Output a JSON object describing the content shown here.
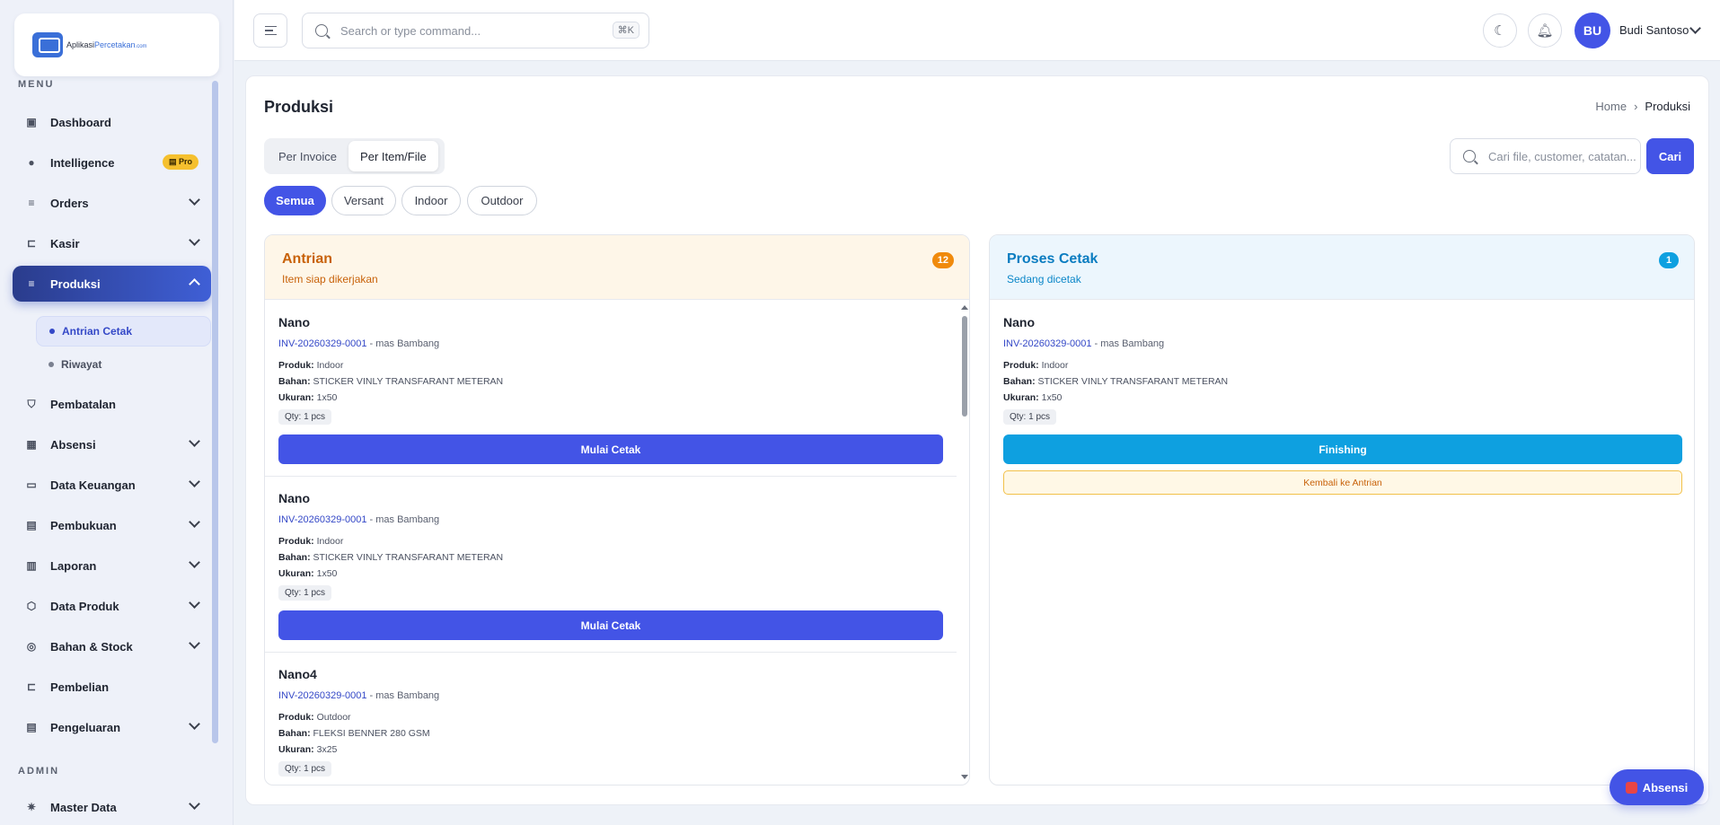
{
  "brand": {
    "logo_prefix": "Aplikasi",
    "logo_highlight": "Percetakan",
    "logo_suffix": ".com"
  },
  "sidebar": {
    "menu_heading": "MENU",
    "admin_heading": "ADMIN",
    "items": [
      {
        "label": "Dashboard"
      },
      {
        "label": "Intelligence",
        "badge": "Pro"
      },
      {
        "label": "Orders"
      },
      {
        "label": "Kasir"
      },
      {
        "label": "Produksi"
      },
      {
        "label": "Pembatalan"
      },
      {
        "label": "Absensi"
      },
      {
        "label": "Data Keuangan"
      },
      {
        "label": "Pembukuan"
      },
      {
        "label": "Laporan"
      },
      {
        "label": "Data Produk"
      },
      {
        "label": "Bahan & Stock"
      },
      {
        "label": "Pembelian"
      },
      {
        "label": "Pengeluaran"
      },
      {
        "label": "Master Data"
      }
    ],
    "sub_items": [
      {
        "label": "Antrian Cetak"
      },
      {
        "label": "Riwayat"
      }
    ]
  },
  "topbar": {
    "search_placeholder": "Search or type command...",
    "shortcut": "⌘K",
    "user_initials": "BU",
    "user_name": "Budi Santoso"
  },
  "page": {
    "title": "Produksi",
    "breadcrumb_home": "Home",
    "breadcrumb_current": "Produksi",
    "tabs": [
      {
        "label": "Per Invoice"
      },
      {
        "label": "Per Item/File"
      }
    ],
    "search_placeholder": "Cari file, customer, catatan...",
    "search_button": "Cari",
    "filters": [
      {
        "label": "Semua"
      },
      {
        "label": "Versant"
      },
      {
        "label": "Indoor"
      },
      {
        "label": "Outdoor"
      }
    ]
  },
  "columns": {
    "antrian": {
      "title": "Antrian",
      "subtitle": "Item siap dikerjakan",
      "count": "12",
      "action_label": "Mulai Cetak",
      "cards": [
        {
          "name": "Nano",
          "invoice": "INV-20260329-0001",
          "customer": " - mas Bambang",
          "produk_label": "Produk:",
          "produk": " Indoor",
          "bahan_label": "Bahan:",
          "bahan": " STICKER VINLY TRANSFARANT METERAN",
          "ukuran_label": "Ukuran:",
          "ukuran": " 1x50",
          "qty": "Qty: 1 pcs"
        },
        {
          "name": "Nano",
          "invoice": "INV-20260329-0001",
          "customer": " - mas Bambang",
          "produk_label": "Produk:",
          "produk": " Indoor",
          "bahan_label": "Bahan:",
          "bahan": " STICKER VINLY TRANSFARANT METERAN",
          "ukuran_label": "Ukuran:",
          "ukuran": " 1x50",
          "qty": "Qty: 1 pcs"
        },
        {
          "name": "Nano4",
          "invoice": "INV-20260329-0001",
          "customer": " - mas Bambang",
          "produk_label": "Produk:",
          "produk": " Outdoor",
          "bahan_label": "Bahan:",
          "bahan": " FLEKSI BENNER 280 GSM",
          "ukuran_label": "Ukuran:",
          "ukuran": " 3x25",
          "qty": "Qty: 1 pcs"
        }
      ]
    },
    "proses": {
      "title": "Proses Cetak",
      "subtitle": "Sedang dicetak",
      "count": "1",
      "finish_label": "Finishing",
      "back_label": "Kembali ke Antrian",
      "cards": [
        {
          "name": "Nano",
          "invoice": "INV-20260329-0001",
          "customer": " - mas Bambang",
          "produk_label": "Produk:",
          "produk": " Indoor",
          "bahan_label": "Bahan:",
          "bahan": " STICKER VINLY TRANSFARANT METERAN",
          "ukuran_label": "Ukuran:",
          "ukuran": " 1x50",
          "qty": "Qty: 1 pcs"
        }
      ]
    }
  },
  "fab": {
    "label": "Absensi"
  },
  "colors": {
    "accent": "#4354e6",
    "antrian": "#f08a0c",
    "proses": "#0ea0e0"
  }
}
